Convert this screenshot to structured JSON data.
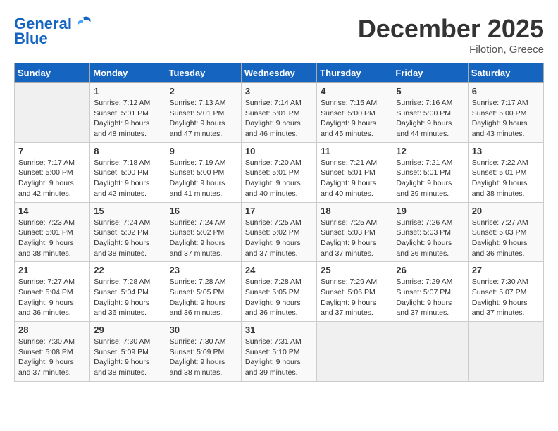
{
  "header": {
    "logo_line1": "General",
    "logo_line2": "Blue",
    "month": "December 2025",
    "location": "Filotion, Greece"
  },
  "days_of_week": [
    "Sunday",
    "Monday",
    "Tuesday",
    "Wednesday",
    "Thursday",
    "Friday",
    "Saturday"
  ],
  "weeks": [
    [
      {
        "day": "",
        "content": ""
      },
      {
        "day": "1",
        "content": "Sunrise: 7:12 AM\nSunset: 5:01 PM\nDaylight: 9 hours\nand 48 minutes."
      },
      {
        "day": "2",
        "content": "Sunrise: 7:13 AM\nSunset: 5:01 PM\nDaylight: 9 hours\nand 47 minutes."
      },
      {
        "day": "3",
        "content": "Sunrise: 7:14 AM\nSunset: 5:01 PM\nDaylight: 9 hours\nand 46 minutes."
      },
      {
        "day": "4",
        "content": "Sunrise: 7:15 AM\nSunset: 5:00 PM\nDaylight: 9 hours\nand 45 minutes."
      },
      {
        "day": "5",
        "content": "Sunrise: 7:16 AM\nSunset: 5:00 PM\nDaylight: 9 hours\nand 44 minutes."
      },
      {
        "day": "6",
        "content": "Sunrise: 7:17 AM\nSunset: 5:00 PM\nDaylight: 9 hours\nand 43 minutes."
      }
    ],
    [
      {
        "day": "7",
        "content": "Sunrise: 7:17 AM\nSunset: 5:00 PM\nDaylight: 9 hours\nand 42 minutes."
      },
      {
        "day": "8",
        "content": "Sunrise: 7:18 AM\nSunset: 5:00 PM\nDaylight: 9 hours\nand 42 minutes."
      },
      {
        "day": "9",
        "content": "Sunrise: 7:19 AM\nSunset: 5:00 PM\nDaylight: 9 hours\nand 41 minutes."
      },
      {
        "day": "10",
        "content": "Sunrise: 7:20 AM\nSunset: 5:01 PM\nDaylight: 9 hours\nand 40 minutes."
      },
      {
        "day": "11",
        "content": "Sunrise: 7:21 AM\nSunset: 5:01 PM\nDaylight: 9 hours\nand 40 minutes."
      },
      {
        "day": "12",
        "content": "Sunrise: 7:21 AM\nSunset: 5:01 PM\nDaylight: 9 hours\nand 39 minutes."
      },
      {
        "day": "13",
        "content": "Sunrise: 7:22 AM\nSunset: 5:01 PM\nDaylight: 9 hours\nand 38 minutes."
      }
    ],
    [
      {
        "day": "14",
        "content": "Sunrise: 7:23 AM\nSunset: 5:01 PM\nDaylight: 9 hours\nand 38 minutes."
      },
      {
        "day": "15",
        "content": "Sunrise: 7:24 AM\nSunset: 5:02 PM\nDaylight: 9 hours\nand 38 minutes."
      },
      {
        "day": "16",
        "content": "Sunrise: 7:24 AM\nSunset: 5:02 PM\nDaylight: 9 hours\nand 37 minutes."
      },
      {
        "day": "17",
        "content": "Sunrise: 7:25 AM\nSunset: 5:02 PM\nDaylight: 9 hours\nand 37 minutes."
      },
      {
        "day": "18",
        "content": "Sunrise: 7:25 AM\nSunset: 5:03 PM\nDaylight: 9 hours\nand 37 minutes."
      },
      {
        "day": "19",
        "content": "Sunrise: 7:26 AM\nSunset: 5:03 PM\nDaylight: 9 hours\nand 36 minutes."
      },
      {
        "day": "20",
        "content": "Sunrise: 7:27 AM\nSunset: 5:03 PM\nDaylight: 9 hours\nand 36 minutes."
      }
    ],
    [
      {
        "day": "21",
        "content": "Sunrise: 7:27 AM\nSunset: 5:04 PM\nDaylight: 9 hours\nand 36 minutes."
      },
      {
        "day": "22",
        "content": "Sunrise: 7:28 AM\nSunset: 5:04 PM\nDaylight: 9 hours\nand 36 minutes."
      },
      {
        "day": "23",
        "content": "Sunrise: 7:28 AM\nSunset: 5:05 PM\nDaylight: 9 hours\nand 36 minutes."
      },
      {
        "day": "24",
        "content": "Sunrise: 7:28 AM\nSunset: 5:05 PM\nDaylight: 9 hours\nand 36 minutes."
      },
      {
        "day": "25",
        "content": "Sunrise: 7:29 AM\nSunset: 5:06 PM\nDaylight: 9 hours\nand 37 minutes."
      },
      {
        "day": "26",
        "content": "Sunrise: 7:29 AM\nSunset: 5:07 PM\nDaylight: 9 hours\nand 37 minutes."
      },
      {
        "day": "27",
        "content": "Sunrise: 7:30 AM\nSunset: 5:07 PM\nDaylight: 9 hours\nand 37 minutes."
      }
    ],
    [
      {
        "day": "28",
        "content": "Sunrise: 7:30 AM\nSunset: 5:08 PM\nDaylight: 9 hours\nand 37 minutes."
      },
      {
        "day": "29",
        "content": "Sunrise: 7:30 AM\nSunset: 5:09 PM\nDaylight: 9 hours\nand 38 minutes."
      },
      {
        "day": "30",
        "content": "Sunrise: 7:30 AM\nSunset: 5:09 PM\nDaylight: 9 hours\nand 38 minutes."
      },
      {
        "day": "31",
        "content": "Sunrise: 7:31 AM\nSunset: 5:10 PM\nDaylight: 9 hours\nand 39 minutes."
      },
      {
        "day": "",
        "content": ""
      },
      {
        "day": "",
        "content": ""
      },
      {
        "day": "",
        "content": ""
      }
    ]
  ]
}
